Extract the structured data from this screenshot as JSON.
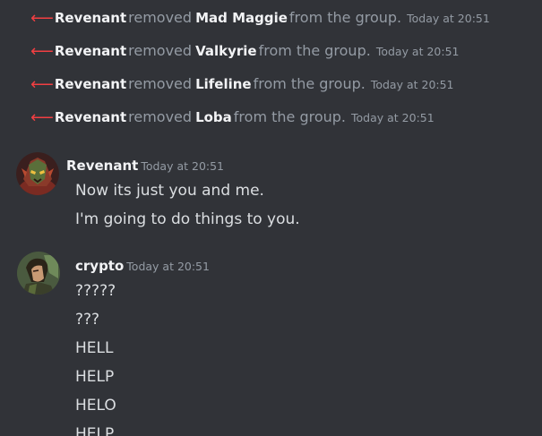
{
  "system_messages": [
    {
      "actor": "Revenant",
      "verb": "removed",
      "target": "Mad Maggie",
      "tail": "from the group.",
      "timestamp": "Today at 20:51"
    },
    {
      "actor": "Revenant",
      "verb": "removed",
      "target": "Valkyrie",
      "tail": "from the group.",
      "timestamp": "Today at 20:51"
    },
    {
      "actor": "Revenant",
      "verb": "removed",
      "target": "Lifeline",
      "tail": "from the group.",
      "timestamp": "Today at 20:51"
    },
    {
      "actor": "Revenant",
      "verb": "removed",
      "target": "Loba",
      "tail": "from the group.",
      "timestamp": "Today at 20:51"
    }
  ],
  "groups": [
    {
      "author": "Revenant",
      "timestamp": "Today at 20:51",
      "avatar_icon": "revenant-avatar",
      "messages": [
        "Now its just you and me.",
        "I'm going to do things to you."
      ]
    },
    {
      "author": "crypto",
      "timestamp": "Today at 20:51",
      "avatar_icon": "crypto-avatar",
      "messages": [
        "?????",
        "???",
        "HELL",
        "HELP",
        "HELO",
        "HELP"
      ]
    }
  ],
  "colors": {
    "background": "#313338",
    "removed_arrow": "#f23f42",
    "username": "#f2f3f5",
    "muted_text": "#949ba4",
    "message_text": "#dbdee1"
  }
}
